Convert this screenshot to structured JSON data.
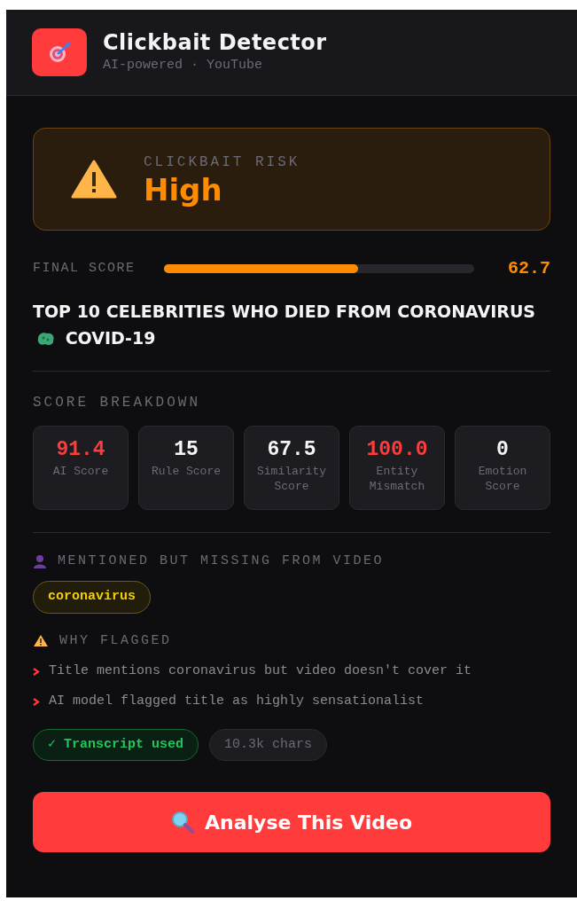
{
  "header": {
    "title": "Clickbait Detector",
    "subtitle": "AI-powered · YouTube"
  },
  "risk": {
    "label": "CLICKBAIT RISK",
    "value": "High"
  },
  "final_score": {
    "label": "FINAL SCORE",
    "level": 0.627,
    "reading": "62.7"
  },
  "video_title": [
    "TOP 10 CELEBRITIES WHO DIED FROM CORONAVIRUS",
    "COVID-19"
  ],
  "breakdown": {
    "heading": "SCORE BREAKDOWN",
    "tiles": [
      {
        "value": "91.4",
        "label": "AI Score",
        "color": "#ff3b3b"
      },
      {
        "value": "15",
        "label": "Rule Score",
        "color": "#f4f4f5"
      },
      {
        "value": "67.5",
        "label": "Similarity Score",
        "color": "#f4f4f5"
      },
      {
        "value": "100.0",
        "label": "Entity Mismatch",
        "color": "#ff3b3b"
      },
      {
        "value": "0",
        "label": "Emotion Score",
        "color": "#f4f4f5"
      }
    ]
  },
  "missing": {
    "heading": "MENTIONED BUT MISSING FROM VIDEO",
    "tags": [
      "coronavirus"
    ]
  },
  "flagged": {
    "heading": "WHY FLAGGED",
    "reasons": [
      "Title mentions coronavirus but video doesn't cover it",
      "AI model flagged title as highly sensationalist"
    ]
  },
  "badges": [
    {
      "kind": "success",
      "text": "✓ Transcript used"
    },
    {
      "kind": "neutral",
      "text": "10.3k chars"
    }
  ],
  "button": {
    "label": "Analyse This Video"
  }
}
